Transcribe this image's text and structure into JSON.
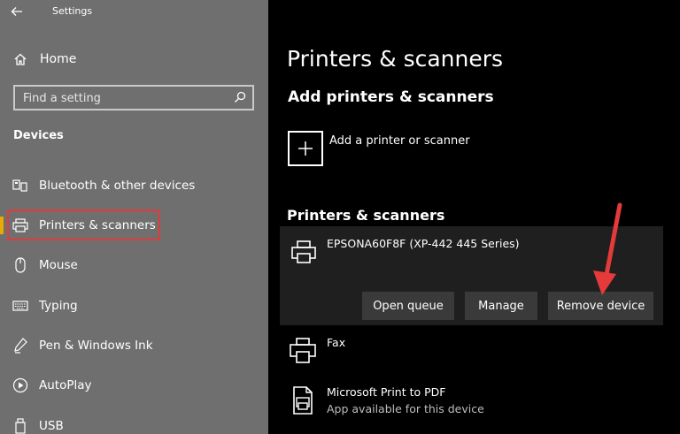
{
  "window": {
    "app_title": "Settings",
    "back_icon": "back-arrow-icon"
  },
  "sidebar": {
    "home_label": "Home",
    "search_placeholder": "Find a setting",
    "section_title": "Devices",
    "items": [
      {
        "label": "Bluetooth & other devices",
        "icon": "bluetooth-devices-icon"
      },
      {
        "label": "Printers & scanners",
        "icon": "printer-icon",
        "active": true
      },
      {
        "label": "Mouse",
        "icon": "mouse-icon"
      },
      {
        "label": "Typing",
        "icon": "keyboard-icon"
      },
      {
        "label": "Pen & Windows Ink",
        "icon": "pen-icon"
      },
      {
        "label": "AutoPlay",
        "icon": "autoplay-icon"
      },
      {
        "label": "USB",
        "icon": "usb-icon"
      }
    ],
    "accent_color": "#e8a900",
    "highlight_color": "#e53a3a"
  },
  "main": {
    "page_title": "Printers & scanners",
    "add_section_title": "Add printers & scanners",
    "add_label": "Add a printer or scanner",
    "list_section_title": "Printers & scanners",
    "selected_printer": {
      "name": "EPSONA60F8F (XP-442 445 Series)",
      "buttons": {
        "open_queue": "Open queue",
        "manage": "Manage",
        "remove": "Remove device"
      }
    },
    "devices": [
      {
        "name": "Fax",
        "sub": ""
      },
      {
        "name": "Microsoft Print to PDF",
        "sub": "App available for this device"
      }
    ],
    "arrow_color": "#e53a3a"
  }
}
